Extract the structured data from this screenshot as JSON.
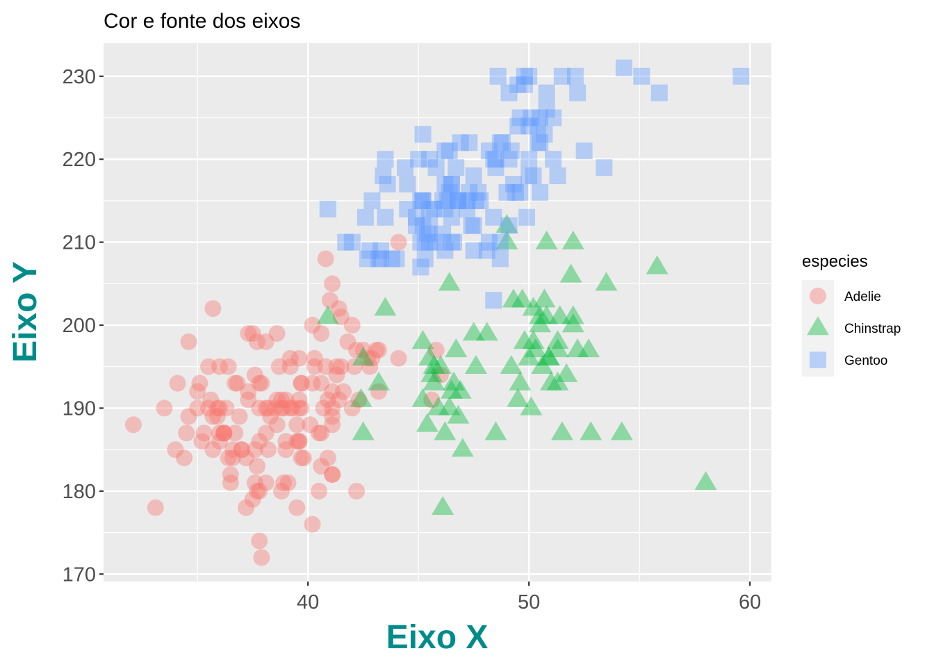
{
  "chart_data": {
    "type": "scatter",
    "title": "Cor e fonte dos eixos",
    "xlabel": "Eixo X",
    "ylabel": "Eixo Y",
    "axis_title_color": "#008B8B",
    "xlim": [
      30.75,
      60.97
    ],
    "ylim": [
      169.1,
      234.0
    ],
    "x_ticks": [
      40,
      50,
      60
    ],
    "y_ticks": [
      170,
      180,
      190,
      200,
      210,
      220,
      230
    ],
    "x_tick_labels": [
      "40",
      "50",
      "60"
    ],
    "y_tick_labels": [
      "170",
      "180",
      "190",
      "200",
      "210",
      "220",
      "230"
    ],
    "grid": true,
    "legend": {
      "title": "especies",
      "position": "right",
      "entries": [
        "Adelie",
        "Chinstrap",
        "Gentoo"
      ]
    },
    "series": [
      {
        "name": "Adelie",
        "shape": "circle",
        "color": "#F8766D",
        "alpha": 0.4,
        "x": [
          39.1,
          39.5,
          40.3,
          36.7,
          39.3,
          38.9,
          39.2,
          34.1,
          42.0,
          37.8,
          37.8,
          41.1,
          38.6,
          34.6,
          36.6,
          38.7,
          42.5,
          34.4,
          46.0,
          37.8,
          37.7,
          35.9,
          38.2,
          38.8,
          35.3,
          40.6,
          40.5,
          37.9,
          40.5,
          39.5,
          37.2,
          39.5,
          40.9,
          36.4,
          39.2,
          38.8,
          42.2,
          37.6,
          39.8,
          36.5,
          40.8,
          36.0,
          44.1,
          37.0,
          39.6,
          41.1,
          37.5,
          36.0,
          42.3,
          39.6,
          40.1,
          35.0,
          42.0,
          34.5,
          41.4,
          39.0,
          40.6,
          36.5,
          37.6,
          35.7,
          41.3,
          37.6,
          41.1,
          36.4,
          41.6,
          35.5,
          41.1,
          35.9,
          41.8,
          33.5,
          39.7,
          39.6,
          45.8,
          35.5,
          42.8,
          40.9,
          37.2,
          36.2,
          42.1,
          34.6,
          42.9,
          36.7,
          35.1,
          37.3,
          41.3,
          36.3,
          36.9,
          38.3,
          38.9,
          35.7,
          41.1,
          34.0,
          39.6,
          36.2,
          40.8,
          38.1,
          40.3,
          33.1,
          43.2,
          35.0,
          41.0,
          37.7,
          37.8,
          37.9,
          39.7,
          38.6,
          38.2,
          38.1,
          43.2,
          38.1,
          45.6,
          39.7,
          42.2,
          39.6,
          42.7,
          38.6,
          37.3,
          35.7,
          41.1,
          36.2,
          37.7,
          40.2,
          41.4,
          35.2,
          40.6,
          38.8,
          41.5,
          39.0,
          44.1,
          38.5,
          43.1,
          36.8,
          37.5,
          38.1,
          41.1,
          35.6,
          40.2,
          37.0,
          39.7,
          40.2,
          40.6,
          32.1,
          40.7,
          37.3,
          39.0,
          39.2,
          36.6,
          36.0,
          37.8,
          36.0,
          41.5
        ],
        "y": [
          181,
          186,
          195,
          193,
          190,
          181,
          195,
          193,
          190,
          186,
          180,
          182,
          191,
          198,
          185,
          195,
          197,
          184,
          194,
          174,
          180,
          189,
          185,
          180,
          187,
          183,
          187,
          172,
          180,
          178,
          178,
          188,
          184,
          195,
          196,
          190,
          180,
          181,
          184,
          182,
          195,
          186,
          196,
          185,
          190,
          182,
          179,
          190,
          191,
          186,
          188,
          190,
          200,
          187,
          191,
          186,
          193,
          181,
          194,
          185,
          195,
          185,
          192,
          184,
          192,
          195,
          188,
          190,
          198,
          190,
          190,
          196,
          197,
          190,
          195,
          191,
          184,
          187,
          195,
          189,
          196,
          187,
          193,
          191,
          194,
          190,
          189,
          189,
          190,
          202,
          205,
          185,
          186,
          187,
          208,
          190,
          196,
          178,
          192,
          192,
          203,
          183,
          190,
          193,
          184,
          199,
          190,
          181,
          197,
          198,
          191,
          193,
          197,
          191,
          196,
          188,
          199,
          189,
          189,
          187,
          198,
          176,
          202,
          186,
          199,
          191,
          195,
          191,
          210,
          190,
          197,
          193,
          199,
          187,
          190,
          191,
          200,
          185,
          193,
          193,
          187,
          188,
          190,
          192,
          185,
          190,
          184,
          195,
          193,
          187,
          201
        ]
      },
      {
        "name": "Chinstrap",
        "shape": "triangle",
        "color": "#00BA38",
        "alpha": 0.4,
        "x": [
          46.5,
          50.0,
          51.3,
          45.4,
          52.7,
          45.2,
          46.1,
          51.3,
          46.0,
          51.3,
          46.6,
          51.7,
          47.0,
          52.0,
          45.9,
          50.5,
          50.3,
          58.0,
          46.4,
          49.2,
          42.4,
          48.5,
          43.2,
          50.6,
          46.7,
          52.0,
          50.5,
          49.5,
          46.4,
          52.8,
          40.9,
          54.2,
          42.5,
          51.0,
          49.7,
          47.5,
          47.6,
          52.0,
          46.9,
          53.5,
          49.0,
          46.2,
          50.9,
          45.5,
          50.9,
          50.8,
          50.1,
          49.0,
          51.5,
          49.8,
          48.1,
          51.4,
          45.7,
          50.7,
          42.5,
          52.2,
          45.2,
          49.3,
          50.2,
          45.6,
          51.9,
          46.8,
          45.7,
          55.8,
          43.5,
          49.6,
          50.8,
          50.2
        ],
        "y": [
          192,
          196,
          193,
          188,
          197,
          198,
          178,
          197,
          195,
          198,
          193,
          194,
          185,
          201,
          190,
          201,
          197,
          181,
          190,
          195,
          191,
          187,
          193,
          195,
          197,
          200,
          200,
          191,
          205,
          187,
          201,
          187,
          196,
          193,
          203,
          199,
          195,
          210,
          192,
          205,
          210,
          187,
          196,
          196,
          196,
          201,
          190,
          212,
          187,
          198,
          199,
          201,
          193,
          203,
          187,
          197,
          191,
          203,
          202,
          194,
          206,
          189,
          195,
          207,
          202,
          193,
          210,
          198
        ]
      },
      {
        "name": "Gentoo",
        "shape": "square",
        "color": "#619CFF",
        "alpha": 0.4,
        "x": [
          46.1,
          50.0,
          48.7,
          50.0,
          47.6,
          46.5,
          45.4,
          46.7,
          43.3,
          46.8,
          40.9,
          49.0,
          45.5,
          48.4,
          45.8,
          49.3,
          42.0,
          49.2,
          46.2,
          48.7,
          50.2,
          45.1,
          46.5,
          46.3,
          42.9,
          46.1,
          47.8,
          48.2,
          50.0,
          47.3,
          42.8,
          45.1,
          59.6,
          49.1,
          48.4,
          42.6,
          44.4,
          44.0,
          48.7,
          42.7,
          49.6,
          45.3,
          49.6,
          50.5,
          43.6,
          45.5,
          50.5,
          44.9,
          45.2,
          46.6,
          48.5,
          45.1,
          50.1,
          46.5,
          45.0,
          43.8,
          45.5,
          43.2,
          50.4,
          45.3,
          46.2,
          45.7,
          54.3,
          45.8,
          49.8,
          46.2,
          49.5,
          43.5,
          50.7,
          47.7,
          46.4,
          48.2,
          46.5,
          46.4,
          48.6,
          47.5,
          51.1,
          45.2,
          45.2,
          49.1,
          52.5,
          47.4,
          50.0,
          44.9,
          50.8,
          43.4,
          51.3,
          47.5,
          52.1,
          47.5,
          52.2,
          45.5,
          49.5,
          44.5,
          50.8,
          49.4,
          46.9,
          48.4,
          51.1,
          48.5,
          55.9,
          47.2,
          49.1,
          47.3,
          46.8,
          41.7,
          53.4,
          43.3,
          48.1,
          50.5,
          49.8,
          43.5,
          51.5,
          46.2,
          55.1,
          44.5,
          48.8,
          47.2,
          46.8,
          50.4,
          45.2,
          49.9
        ],
        "y": [
          211,
          230,
          210,
          218,
          215,
          210,
          211,
          219,
          209,
          215,
          214,
          216,
          214,
          213,
          210,
          217,
          210,
          221,
          209,
          222,
          218,
          215,
          213,
          215,
          215,
          215,
          215,
          210,
          220,
          222,
          209,
          207,
          230,
          220,
          220,
          213,
          219,
          208,
          208,
          208,
          225,
          210,
          216,
          222,
          217,
          210,
          225,
          213,
          215,
          210,
          220,
          210,
          225,
          217,
          220,
          208,
          220,
          208,
          224,
          208,
          221,
          214,
          231,
          219,
          230,
          214,
          229,
          220,
          223,
          216,
          221,
          221,
          217,
          216,
          230,
          209,
          220,
          215,
          223,
          212,
          221,
          212,
          224,
          212,
          228,
          218,
          218,
          212,
          230,
          218,
          228,
          212,
          224,
          214,
          226,
          216,
          222,
          203,
          225,
          219,
          228,
          215,
          228,
          216,
          215,
          210,
          219,
          208,
          209,
          216,
          229,
          213,
          230,
          217,
          230,
          217,
          222,
          214,
          215,
          222,
          212,
          213
        ]
      }
    ]
  }
}
